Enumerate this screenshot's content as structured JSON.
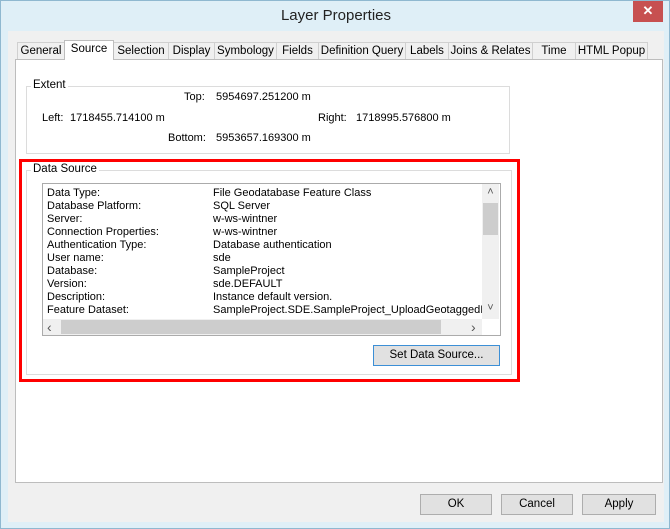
{
  "window": {
    "title": "Layer Properties",
    "close": "✕"
  },
  "tabs": [
    "General",
    "Source",
    "Selection",
    "Display",
    "Symbology",
    "Fields",
    "Definition Query",
    "Labels",
    "Joins & Relates",
    "Time",
    "HTML Popup"
  ],
  "active_tab": "Source",
  "extent": {
    "label": "Extent",
    "top_label": "Top:",
    "top": "5954697.251200 m",
    "left_label": "Left:",
    "left": "1718455.714100 m",
    "right_label": "Right:",
    "right": "1718995.576800 m",
    "bottom_label": "Bottom:",
    "bottom": "5953657.169300 m"
  },
  "data_source": {
    "label": "Data Source",
    "rows": [
      {
        "k": "Data Type:",
        "v": "File Geodatabase Feature Class"
      },
      {
        "k": "Database Platform:",
        "v": "SQL Server"
      },
      {
        "k": "Server:",
        "v": "w-ws-wintner"
      },
      {
        "k": "Connection Properties:",
        "v": "w-ws-wintner"
      },
      {
        "k": "Authentication Type:",
        "v": "Database authentication"
      },
      {
        "k": "User name:",
        "v": "sde"
      },
      {
        "k": "Database:",
        "v": "SampleProject"
      },
      {
        "k": "Version:",
        "v": "sde.DEFAULT"
      },
      {
        "k": "Description:",
        "v": "Instance default version."
      },
      {
        "k": "Feature Dataset:",
        "v": "SampleProject.SDE.SampleProject_UploadGeotaggedIm"
      }
    ],
    "set_button": "Set Data Source...",
    "highlight_color": "#ff0000"
  },
  "scroll": {
    "up": "˄",
    "down": "˅",
    "left": "‹",
    "right": "›"
  },
  "buttons": {
    "ok": "OK",
    "cancel": "Cancel",
    "apply": "Apply"
  }
}
